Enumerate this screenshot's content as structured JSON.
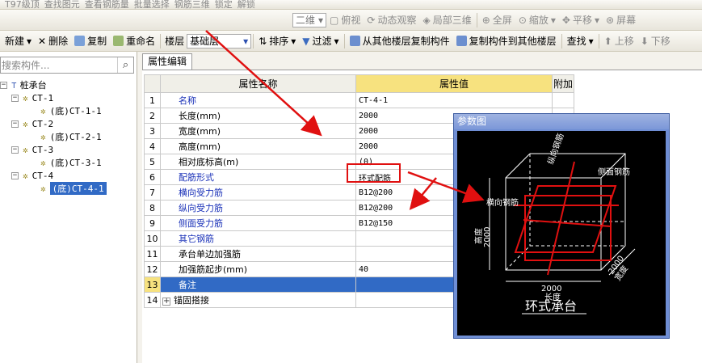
{
  "toolbar_top": {
    "items": [
      "T97级顶",
      "查找图元",
      "查看钢筋量",
      "批量选择",
      "钢筋三维",
      "锁定",
      "解锁"
    ]
  },
  "toolbar_view": {
    "view2d": "二维",
    "items": [
      "俯视",
      "动态观察",
      "局部三维",
      "全屏",
      "缩放",
      "平移",
      "屏幕"
    ]
  },
  "toolbar_main": {
    "new": "新建",
    "delete": "删除",
    "copy": "复制",
    "rename": "重命名",
    "floor_label": "楼层",
    "floor_value": "基础层",
    "sort": "排序",
    "filter": "过滤",
    "copy_from_floor": "从其他楼层复制构件",
    "copy_to_floor": "复制构件到其他楼层",
    "find": "查找",
    "move_up": "上移",
    "move_down": "下移"
  },
  "search": {
    "placeholder": "搜索构件..."
  },
  "tree": {
    "root": "桩承台",
    "nodes": [
      {
        "label": "CT-1",
        "child": "(底)CT-1-1"
      },
      {
        "label": "CT-2",
        "child": "(底)CT-2-1"
      },
      {
        "label": "CT-3",
        "child": "(底)CT-3-1"
      },
      {
        "label": "CT-4",
        "child": "(底)CT-4-1"
      }
    ]
  },
  "tab": {
    "label": "属性编辑"
  },
  "grid": {
    "headers": {
      "name": "属性名称",
      "value": "属性值",
      "extra": "附加"
    },
    "rows": [
      {
        "n": "1",
        "name": "名称",
        "value": "CT-4-1"
      },
      {
        "n": "2",
        "name": "长度(mm)",
        "value": "2000"
      },
      {
        "n": "3",
        "name": "宽度(mm)",
        "value": "2000"
      },
      {
        "n": "4",
        "name": "高度(mm)",
        "value": "2000"
      },
      {
        "n": "5",
        "name": "相对底标高(m)",
        "value": "(0)"
      },
      {
        "n": "6",
        "name": "配筋形式",
        "value": "环式配筋"
      },
      {
        "n": "7",
        "name": "横向受力筋",
        "value": "B12@200"
      },
      {
        "n": "8",
        "name": "纵向受力筋",
        "value": "B12@200"
      },
      {
        "n": "9",
        "name": "侧面受力筋",
        "value": "B12@150"
      },
      {
        "n": "10",
        "name": "其它钢筋",
        "value": ""
      },
      {
        "n": "11",
        "name": "承台单边加强筋",
        "value": ""
      },
      {
        "n": "12",
        "name": "加强筋起步(mm)",
        "value": "40"
      },
      {
        "n": "13",
        "name": "备注",
        "value": ""
      },
      {
        "n": "14",
        "name": "锚固搭接",
        "value": ""
      }
    ]
  },
  "popup": {
    "title": "参数图",
    "labels": {
      "longitudinal": "纵向钢筋",
      "side": "侧面钢筋",
      "transverse": "横向钢筋",
      "height_label": "高度",
      "height_value": "2000",
      "width_label": "宽度",
      "width_value": "2000",
      "length_value": "2000",
      "length_label": "长度",
      "caption": "环式承台"
    }
  },
  "colors": {
    "accent_red": "#e01010",
    "selection": "#316ac5",
    "header_yellow": "#f7e27f"
  }
}
